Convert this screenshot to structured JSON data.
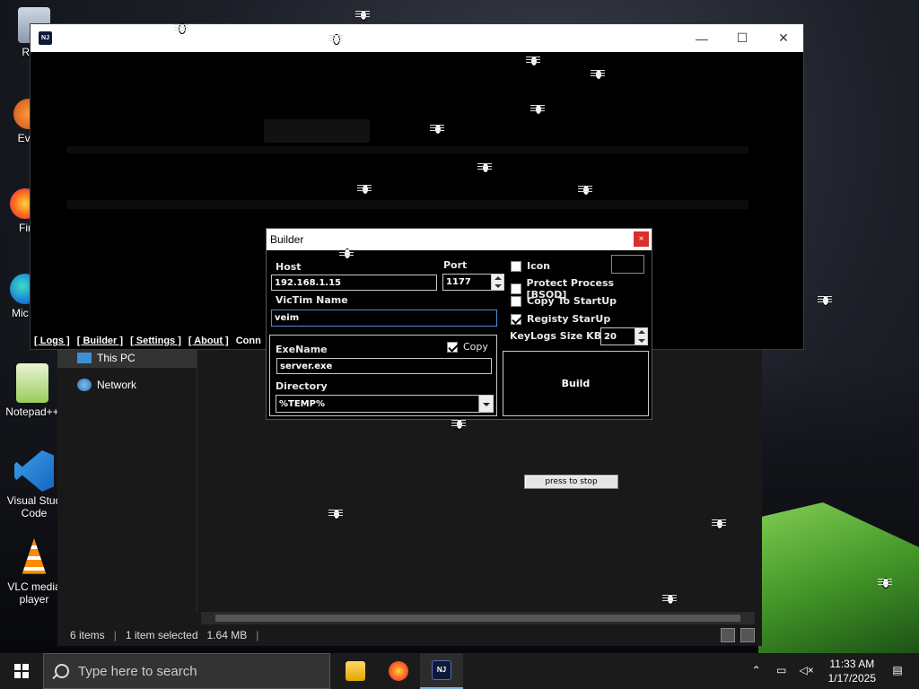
{
  "desktop": {
    "icons": [
      {
        "label": "Recy"
      },
      {
        "label": "Ever"
      },
      {
        "label": "Fir"
      },
      {
        "label": "Mic E"
      },
      {
        "label": "Notepad++"
      },
      {
        "label": "Visual Stud Code"
      },
      {
        "label": "VLC media player"
      }
    ]
  },
  "explorer": {
    "nav": [
      {
        "label": "This PC",
        "icon": "monitor-icon"
      },
      {
        "label": "Network",
        "icon": "network-icon"
      }
    ],
    "status": {
      "items": "6 items",
      "selected": "1 item selected",
      "size": "1.64 MB"
    }
  },
  "main_window": {
    "icon_text": "NJ",
    "controls": {
      "minimize": "—",
      "maximize": "☐",
      "close": "✕"
    },
    "menu": [
      "[ Logs ]",
      "[ Builder ]",
      "[ Settings ]",
      "[ About ]",
      "Conn"
    ]
  },
  "builder": {
    "title": "Builder",
    "close": "×",
    "host_label": "Host",
    "host_value": "192.168.1.15",
    "port_label": "Port",
    "port_value": "1177",
    "victim_label": "VicTim Name",
    "victim_value": "veim",
    "exename_label": "ExeName",
    "copy_label": "Copy",
    "copy_checked": true,
    "exename_value": "server.exe",
    "directory_label": "Directory",
    "directory_value": "%TEMP%",
    "icon_label": "Icon",
    "icon_checked": false,
    "protect_label": "Protect Process [BSOD]",
    "protect_checked": false,
    "copy_startup_label": "Copy To StartUp",
    "copy_startup_checked": false,
    "registry_label": "Registy StarUp",
    "registry_checked": true,
    "keylogs_label": "KeyLogs Size KB",
    "keylogs_value": "20",
    "build_label": "Build"
  },
  "press_to_stop": "press to stop",
  "taskbar": {
    "search_placeholder": "Type here to search",
    "time": "11:33 AM",
    "date": "1/17/2025",
    "colors": {
      "explorer": "#f0c33c",
      "firefox": "#ff7139",
      "njrat": "#0f1a3a"
    }
  }
}
